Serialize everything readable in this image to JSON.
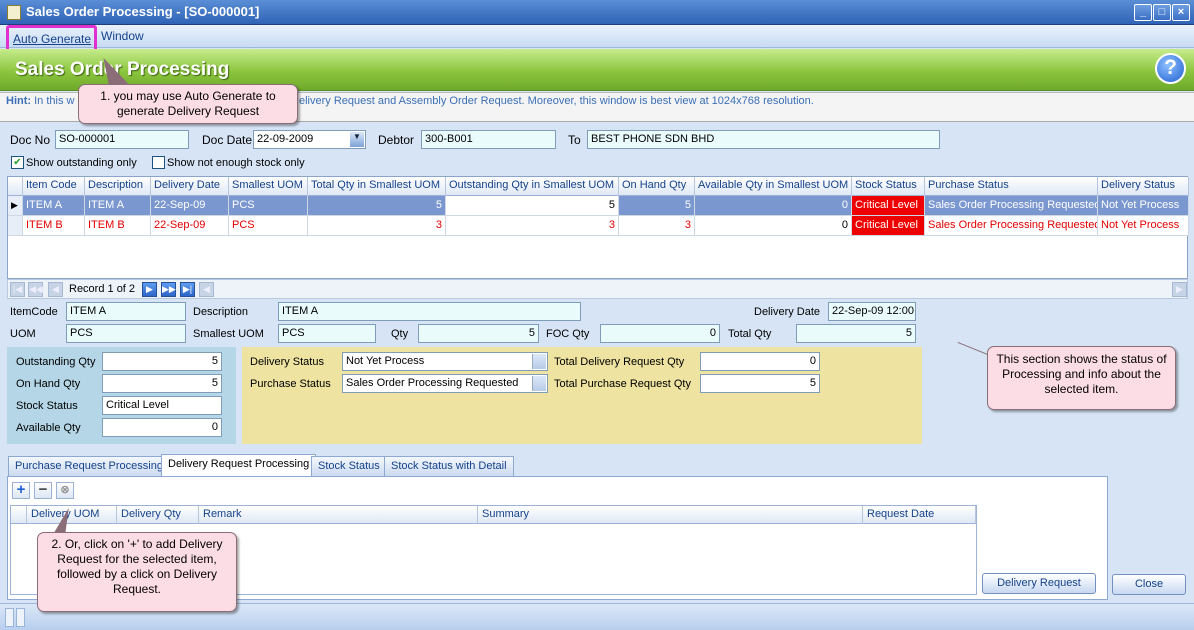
{
  "window": {
    "title": "Sales Order Processing - [SO-000001]",
    "controls": [
      "minimize-icon",
      "maximize-icon",
      "close-icon"
    ]
  },
  "menu": {
    "items": [
      "Auto Generate",
      "Window"
    ]
  },
  "header": {
    "title": "Sales Order Processing",
    "help_icon": "?"
  },
  "hint": {
    "label": "Hint:",
    "text_left": "In this w",
    "text_right": "elivery Request and Assembly Order Request. Moreover, this window is best view at 1024x768 resolution."
  },
  "doc": {
    "doc_no_label": "Doc No",
    "doc_no": "SO-000001",
    "doc_date_label": "Doc Date",
    "doc_date": "22-09-2009",
    "debtor_label": "Debtor",
    "debtor": "300-B001",
    "to_label": "To",
    "to": "BEST PHONE SDN BHD"
  },
  "filters": {
    "show_outstanding": "Show outstanding only",
    "show_not_enough": "Show not enough stock only"
  },
  "grid": {
    "columns": [
      "Item Code",
      "Description",
      "Delivery Date",
      "Smallest UOM",
      "Total Qty in Smallest UOM",
      "Outstanding Qty in Smallest UOM",
      "On Hand Qty",
      "Available Qty in Smallest UOM",
      "Stock Status",
      "Purchase Status",
      "Delivery Status"
    ],
    "rows": [
      [
        "ITEM A",
        "ITEM A",
        "22-Sep-09",
        "PCS",
        "5",
        "5",
        "5",
        "0",
        "Critical Level",
        "Sales Order Processing Requested",
        "Not Yet Process"
      ],
      [
        "ITEM B",
        "ITEM B",
        "22-Sep-09",
        "PCS",
        "3",
        "3",
        "3",
        "0",
        "Critical Level",
        "Sales Order Processing Requested",
        "Not Yet Process"
      ]
    ]
  },
  "navigator": {
    "record_text": "Record 1 of 2"
  },
  "detail": {
    "itemcode_label": "ItemCode",
    "itemcode": "ITEM A",
    "description_label": "Description",
    "description": "ITEM A",
    "delivery_date_label": "Delivery Date",
    "delivery_date": "22-Sep-09 12:00",
    "uom_label": "UOM",
    "uom": "PCS",
    "smallest_uom_label": "Smallest UOM",
    "smallest_uom": "PCS",
    "qty_label": "Qty",
    "qty": "5",
    "foc_qty_label": "FOC Qty",
    "foc_qty": "0",
    "total_qty_label": "Total Qty",
    "total_qty": "5",
    "outstanding_qty_label": "Outstanding Qty",
    "outstanding_qty": "5",
    "on_hand_qty_label": "On Hand Qty",
    "on_hand_qty": "5",
    "stock_status_label": "Stock Status",
    "stock_status": "Critical Level",
    "available_qty_label": "Available Qty",
    "available_qty": "0",
    "delivery_status_label": "Delivery Status",
    "delivery_status": "Not Yet Process",
    "purchase_status_label": "Purchase Status",
    "purchase_status": "Sales Order Processing Requested",
    "total_delivery_request_qty_label": "Total Delivery Request Qty",
    "total_delivery_request_qty": "0",
    "total_purchase_request_qty_label": "Total Purchase Request Qty",
    "total_purchase_request_qty": "5"
  },
  "tabs": [
    "Purchase Request Processing",
    "Delivery Request Processing",
    "Stock Status",
    "Stock Status with Detail"
  ],
  "subgrid": {
    "columns": [
      "Delivery UOM",
      "Delivery Qty",
      "Remark",
      "Summary",
      "Request Date"
    ]
  },
  "buttons": {
    "delivery_request": "Delivery Request",
    "close": "Close"
  },
  "callouts": {
    "c1": "1. you may use Auto Generate to generate Delivery Request",
    "c2": "This section shows the status of Processing and info about the selected item.",
    "c3": "2. Or, click on '+' to add Delivery Request for the selected item, followed by a click on Delivery Request."
  },
  "colors": {
    "header_green": "#8cc63f",
    "selected_row": "#7b97cf",
    "critical": "#ee0000",
    "callout": "#fcdde6"
  }
}
